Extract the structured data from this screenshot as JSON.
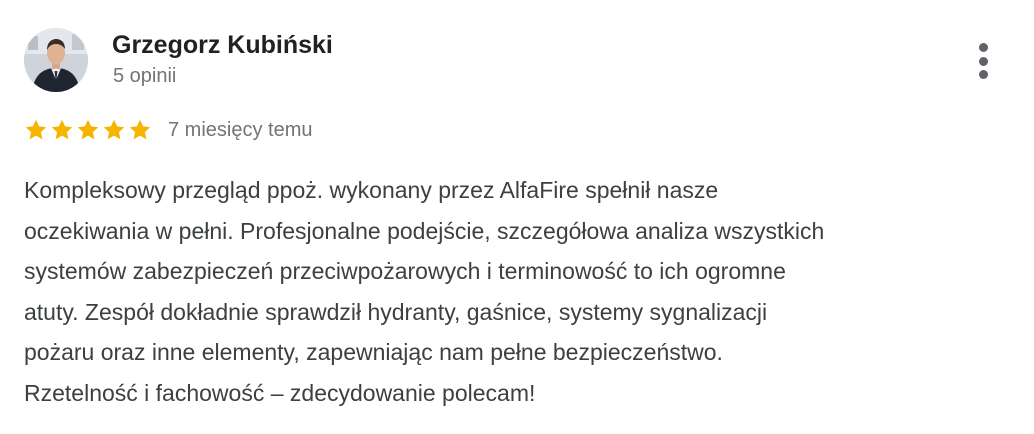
{
  "review": {
    "author": {
      "name": "Grzegorz Kubiński",
      "review_count": "5 opinii",
      "avatar_icon": "user-photo-avatar"
    },
    "menu_icon": "more-vert-icon",
    "rating": {
      "stars": 5,
      "max_stars": 5,
      "star_color": "#f4b400",
      "star_icon": "star-icon"
    },
    "time_ago": "7 miesięcy temu",
    "text_lines": [
      "Kompleksowy przegląd ppoż. wykonany przez AlfaFire spełnił nasze",
      "oczekiwania w pełni. Profesjonalne podejście, szczegółowa analiza wszystkich",
      "systemów zabezpieczeń przeciwpożarowych i terminowość to ich ogromne",
      "atuty. Zespół dokładnie sprawdził hydranty, gaśnice, systemy sygnalizacji",
      "pożaru oraz inne elementy, zapewniając nam pełne bezpieczeństwo.",
      "Rzetelność i fachowość – zdecydowanie polecam!"
    ],
    "colors": {
      "name": "#202124",
      "secondary": "#70757a",
      "body": "#3c4043"
    }
  }
}
